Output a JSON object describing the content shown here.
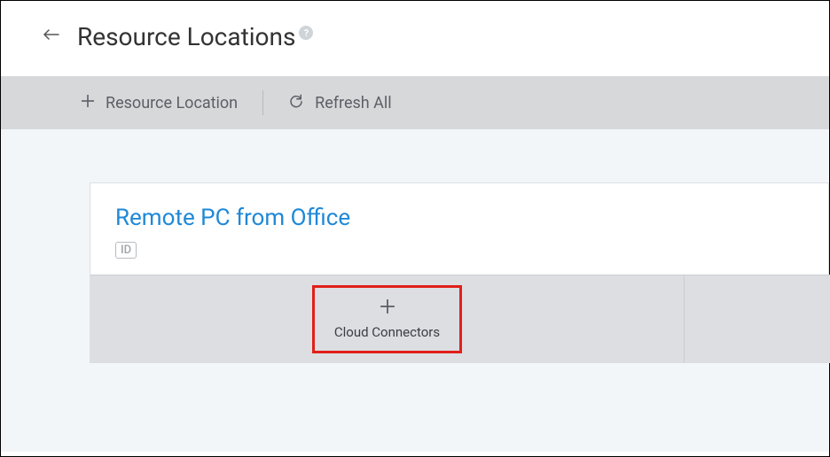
{
  "header": {
    "title": "Resource Locations"
  },
  "toolbar": {
    "add_label": "Resource Location",
    "refresh_label": "Refresh All"
  },
  "resource": {
    "name": "Remote PC from Office",
    "id_badge": "ID",
    "cloud_connectors_label": "Cloud Connectors"
  }
}
